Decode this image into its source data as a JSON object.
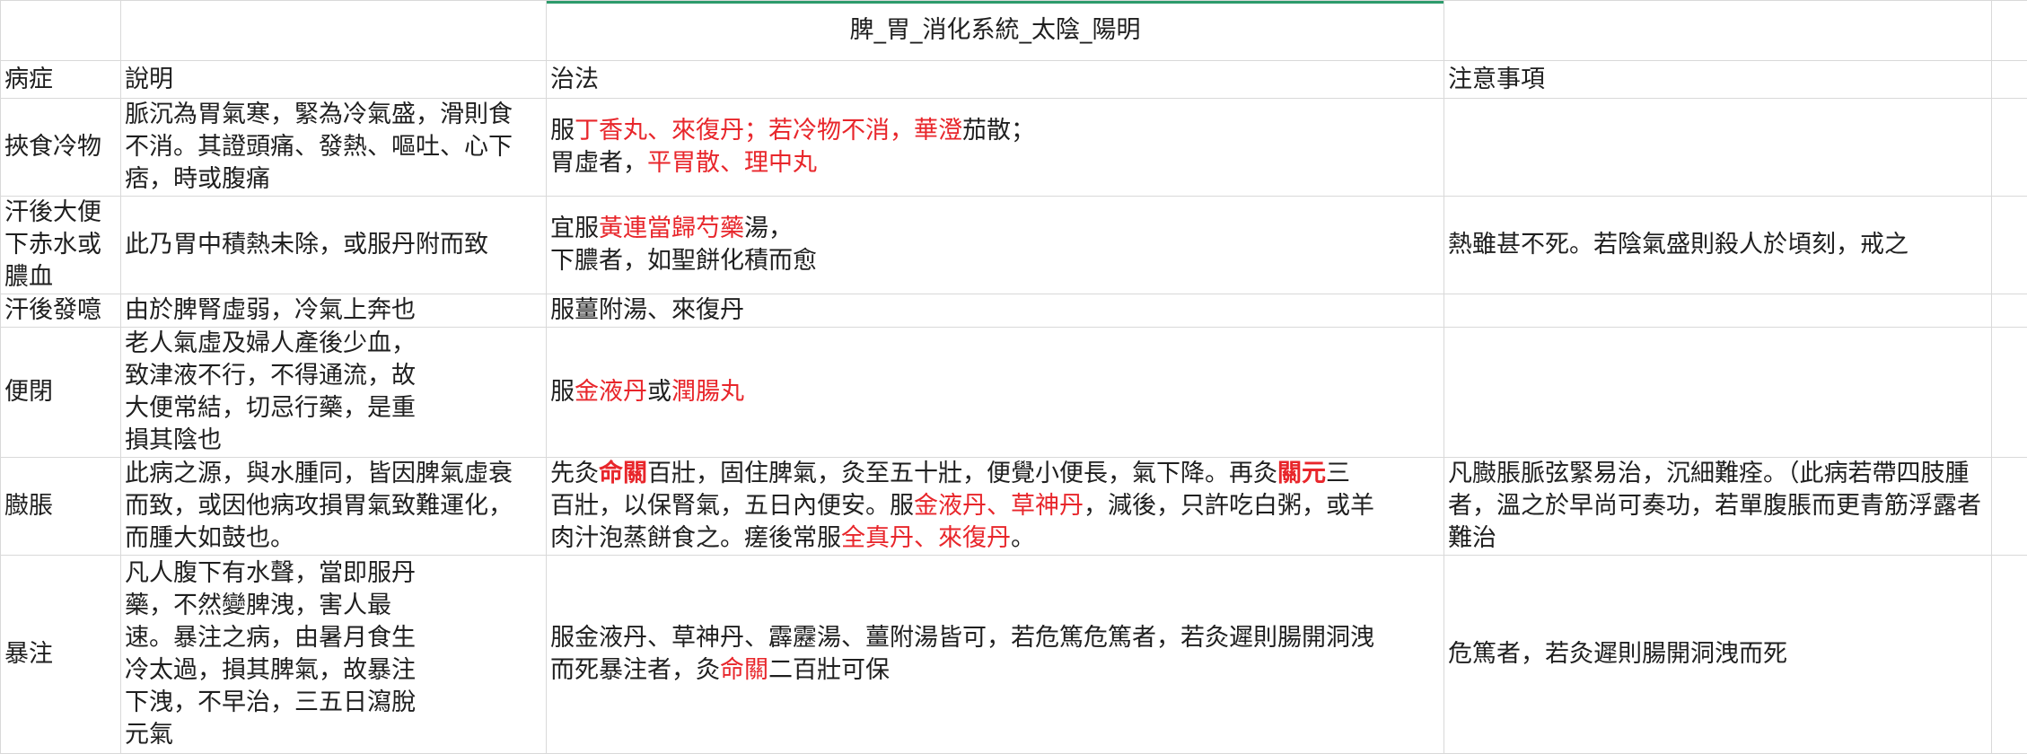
{
  "title": "脾_胃_消化系統_太陰_陽明",
  "headers": [
    "病症",
    "說明",
    "治法",
    "注意事項"
  ],
  "rows": [
    {
      "disease": "挾食冷物",
      "desc_lines": [
        "脈沉為胃氣寒，緊為冷氣盛，滑則食",
        "不消。其證頭痛、發熱、嘔吐、心下",
        "痞，時或腹痛"
      ],
      "treat_lines": [
        [
          {
            "t": "服",
            "c": ""
          },
          {
            "t": "丁香丸、來復丹；若冷物不消，華澄",
            "c": "red"
          },
          {
            "t": "茄散；",
            "c": ""
          }
        ],
        [
          {
            "t": "胃虛者，",
            "c": ""
          },
          {
            "t": "平胃散、理中丸",
            "c": "red"
          }
        ]
      ],
      "note": ""
    },
    {
      "disease_lines": [
        "汗後大便",
        "下赤水或",
        "膿血"
      ],
      "desc": "此乃胃中積熱未除，或服丹附而致",
      "treat_lines": [
        [
          {
            "t": "宜服",
            "c": ""
          },
          {
            "t": "黃連當歸芍藥",
            "c": "red"
          },
          {
            "t": "湯，",
            "c": ""
          }
        ],
        [
          {
            "t": "下膿者，如聖餅化積而愈",
            "c": ""
          }
        ]
      ],
      "note": "熱雖甚不死。若陰氣盛則殺人於頃刻，戒之"
    },
    {
      "disease": "汗後發噫",
      "desc": "由於脾腎虛弱，冷氣上奔也",
      "treat": "服薑附湯、來復丹",
      "note": ""
    },
    {
      "disease": "便閉",
      "desc_lines": [
        "老人氣虛及婦人產後少血，",
        "致津液不行，不得通流，故",
        "大便常結，切忌行藥，是重",
        "損其陰也"
      ],
      "treat_lines": [
        [
          {
            "t": "服",
            "c": ""
          },
          {
            "t": "金液丹",
            "c": "red"
          },
          {
            "t": "或",
            "c": ""
          },
          {
            "t": "潤腸丸",
            "c": "red"
          }
        ]
      ],
      "note": ""
    },
    {
      "disease": "臌脹",
      "desc_lines": [
        "此病之源，與水腫同，皆因脾氣虛衰",
        "而致，或因他病攻損胃氣致難運化，",
        "而腫大如鼓也。"
      ],
      "treat_lines": [
        [
          {
            "t": "先灸",
            "c": ""
          },
          {
            "t": "命關",
            "c": "red-b"
          },
          {
            "t": "百壯，固住脾氣，灸至五十壯，便覺小便長，氣下降。再灸",
            "c": ""
          },
          {
            "t": "關元",
            "c": "red-b"
          },
          {
            "t": "三",
            "c": ""
          }
        ],
        [
          {
            "t": "百壯，以保腎氣，五日內便安。服",
            "c": ""
          },
          {
            "t": "金液丹、草神丹",
            "c": "red"
          },
          {
            "t": "，減後，只許吃白粥，或羊",
            "c": ""
          }
        ],
        [
          {
            "t": "肉汁泡蒸餅食之。瘥後常服",
            "c": ""
          },
          {
            "t": "全真丹、來復丹",
            "c": "red"
          },
          {
            "t": "。",
            "c": ""
          }
        ]
      ],
      "note_lines": [
        "凡臌脹脈弦緊易治，沉細難痊。（此病若帶四肢腫",
        "者，溫之於早尚可奏功，若單腹脹而更青筋浮露者",
        "難治"
      ]
    },
    {
      "disease": "暴注",
      "desc_lines": [
        "凡人腹下有水聲，當即服丹",
        "藥，不然變脾洩，害人最",
        "速。暴注之病，由暑月食生",
        "冷太過，損其脾氣，故暴注",
        "下洩，不早治，三五日瀉脫",
        "元氣"
      ],
      "treat_lines": [
        [
          {
            "t": "服金液丹、草神丹、霹靂湯、薑附湯皆可，若危篤危篤者，若灸遲則腸開洞洩",
            "c": ""
          }
        ],
        [
          {
            "t": "而死暴注者，灸",
            "c": ""
          },
          {
            "t": "命關",
            "c": "red"
          },
          {
            "t": "二百壯可保",
            "c": ""
          }
        ]
      ],
      "note": "危篤者，若灸遲則腸開洞洩而死"
    }
  ]
}
